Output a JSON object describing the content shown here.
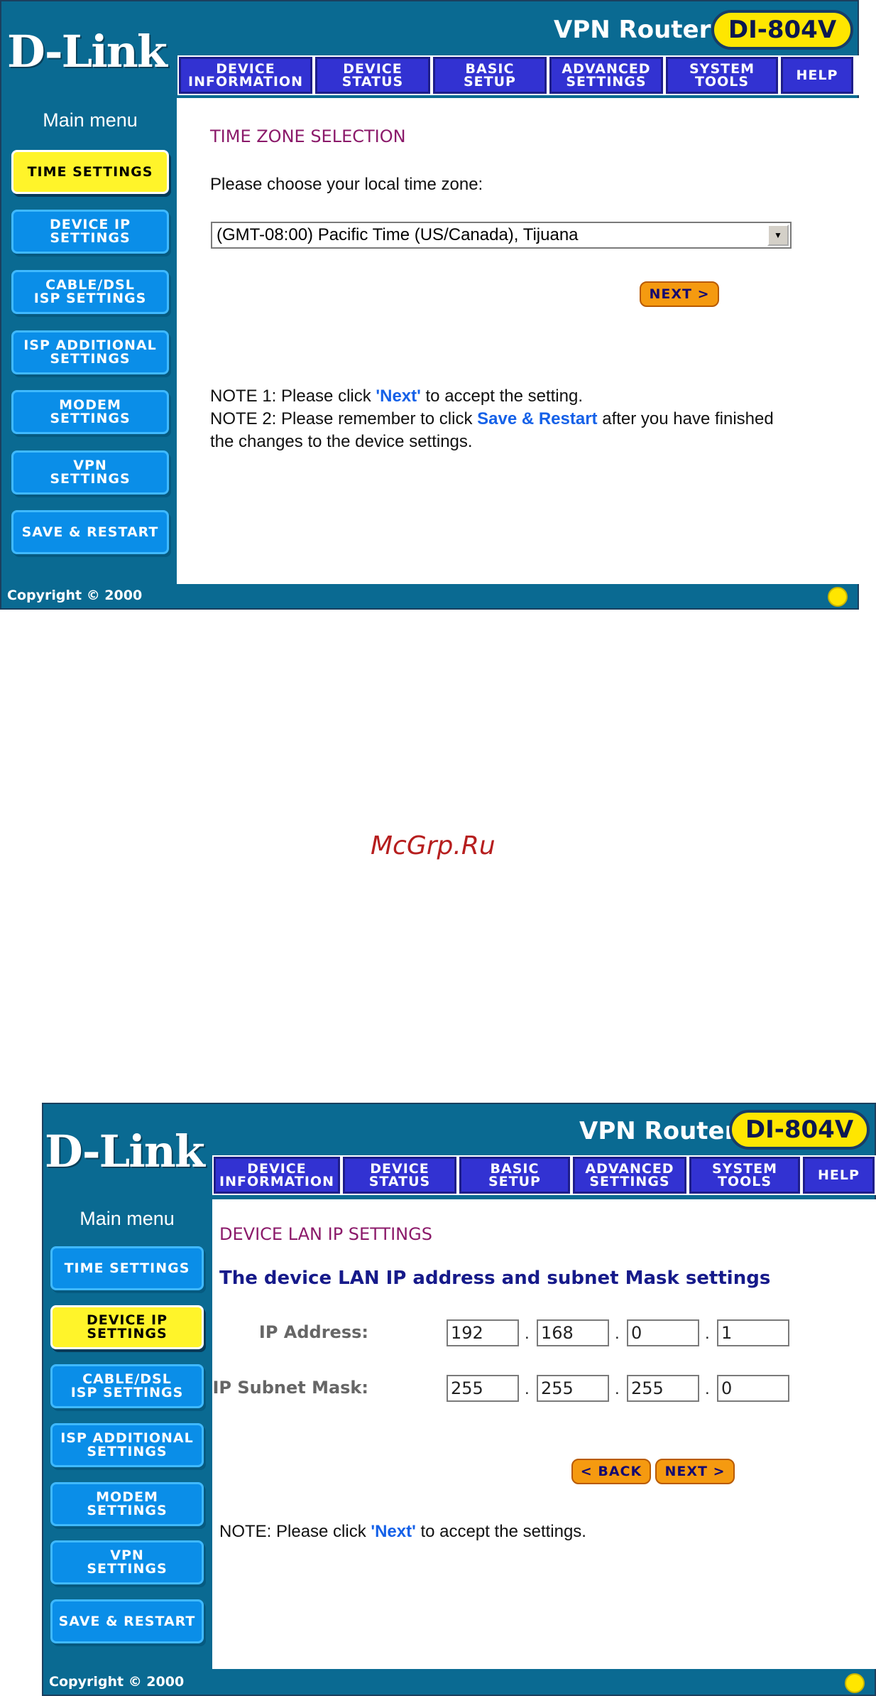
{
  "screen1": {
    "brand": "D-Link",
    "product": "VPN Router",
    "model": "DI-804V",
    "nav": [
      "DEVICE\nINFORMATION",
      "DEVICE\nSTATUS",
      "BASIC\nSETUP",
      "ADVANCED\nSETTINGS",
      "SYSTEM\nTOOLS",
      "HELP"
    ],
    "menu_title": "Main menu",
    "menu": [
      "TIME SETTINGS",
      "DEVICE IP\nSETTINGS",
      "CABLE/DSL\nISP SETTINGS",
      "ISP ADDITIONAL\nSETTINGS",
      "MODEM\nSETTINGS",
      "VPN\nSETTINGS",
      "SAVE & RESTART"
    ],
    "active_menu": "TIME SETTINGS",
    "section_title": "TIME ZONE SELECTION",
    "prompt": "Please choose your local time zone:",
    "timezone": "(GMT-08:00) Pacific Time (US/Canada), Tijuana",
    "next_button": "NEXT >",
    "note1_a": "NOTE 1: Please click ",
    "note1_link": "'Next'",
    "note1_b": " to accept the setting.",
    "note2_a": "NOTE 2: Please remember to click ",
    "note2_link": "Save & Restart",
    "note2_b": " after you have finished",
    "note2_c": "the changes to the device settings.",
    "copyright": "Copyright © 2000"
  },
  "watermark": "McGrp.Ru",
  "screen2": {
    "brand": "D-Link",
    "product": "VPN Router",
    "model": "DI-804V",
    "nav": [
      "DEVICE\nINFORMATION",
      "DEVICE\nSTATUS",
      "BASIC\nSETUP",
      "ADVANCED\nSETTINGS",
      "SYSTEM\nTOOLS",
      "HELP"
    ],
    "menu_title": "Main menu",
    "menu": [
      "TIME SETTINGS",
      "DEVICE IP\nSETTINGS",
      "CABLE/DSL\nISP SETTINGS",
      "ISP ADDITIONAL\nSETTINGS",
      "MODEM\nSETTINGS",
      "VPN\nSETTINGS",
      "SAVE & RESTART"
    ],
    "active_menu": "DEVICE IP\nSETTINGS",
    "section_title": "DEVICE LAN IP SETTINGS",
    "subtitle": "The device LAN IP address and subnet Mask settings",
    "ip_label": "IP Address:",
    "ip": [
      "192",
      "168",
      "0",
      "1"
    ],
    "mask_label": "IP Subnet Mask:",
    "mask": [
      "255",
      "255",
      "255",
      "0"
    ],
    "back_button": "< BACK",
    "next_button": "NEXT >",
    "note_a": "NOTE: Please click ",
    "note_link": "'Next'",
    "note_b": " to accept the settings.",
    "copyright": "Copyright © 2000"
  }
}
